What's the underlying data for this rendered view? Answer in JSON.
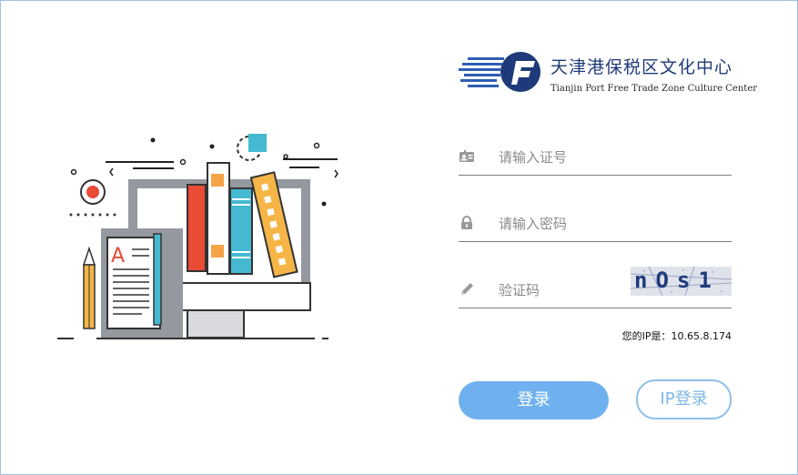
{
  "brand": {
    "name_cn": "天津港保税区文化中心",
    "name_en": "Tianjin Port Free Trade Zone Culture Center",
    "colors": {
      "primary": "#1f3a7a",
      "accent": "#2e5fb0"
    }
  },
  "form": {
    "card_field": {
      "placeholder": "请输入证号",
      "value": "",
      "icon": "id-card-icon"
    },
    "password_field": {
      "placeholder": "请输入密码",
      "value": "",
      "icon": "lock-icon"
    },
    "captcha_field": {
      "placeholder": "验证码",
      "value": "",
      "icon": "pencil-icon"
    },
    "captcha_image": {
      "text": "nOs1"
    }
  },
  "ip_info": {
    "text": "您的IP是：10.65.8.174"
  },
  "buttons": {
    "login": {
      "label": "登录",
      "color": "#6fb1ee"
    },
    "ip_login": {
      "label": "IP登录",
      "color": "#8fc0ea"
    }
  },
  "illustration": {
    "letter": "A"
  }
}
